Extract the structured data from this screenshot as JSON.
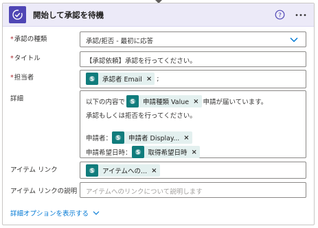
{
  "header": {
    "title": "開始して承認を待機",
    "accent_color": "#4f46b5",
    "background": "#eceaf8"
  },
  "fields": {
    "approval_type": {
      "label": "承認の種類",
      "required_mark": "*",
      "value": "承認/拒否 - 最初に応答"
    },
    "title": {
      "label": "タイトル",
      "required_mark": "*",
      "value": "【承認依頼】承認を行ってください。"
    },
    "assigned_to": {
      "label": "担当者",
      "required_mark": "*",
      "token": "承認者 Email",
      "separator": ";"
    },
    "details": {
      "label": "詳細",
      "line1_prefix": "以下の内容で",
      "line1_token": "申請種類 Value",
      "line1_suffix": "申請が届いています。",
      "line2": "承認もしくは拒否を行ってください。",
      "line3_prefix": "申請者：",
      "line3_token": "申請者 Display...",
      "line4_prefix": "申請希望日時：",
      "line4_token": "取得希望日時"
    },
    "item_link": {
      "label": "アイテム リンク",
      "token": "アイテムへの..."
    },
    "item_link_description": {
      "label": "アイテム リンクの説明",
      "placeholder": "アイテムへのリンクについて説明します"
    }
  },
  "footer": {
    "advanced_options": "詳細オプションを表示する"
  },
  "token_x": "×",
  "icons": {
    "header": "approval-icon",
    "help": "help-circle-icon",
    "more": "more-icon",
    "token": "sharepoint-icon",
    "dropdown": "chevron-down-icon"
  },
  "colors": {
    "token_bg": "#e3f0ef",
    "token_icon": "#107c7c",
    "link": "#0078d4",
    "required": "#a4262c"
  }
}
